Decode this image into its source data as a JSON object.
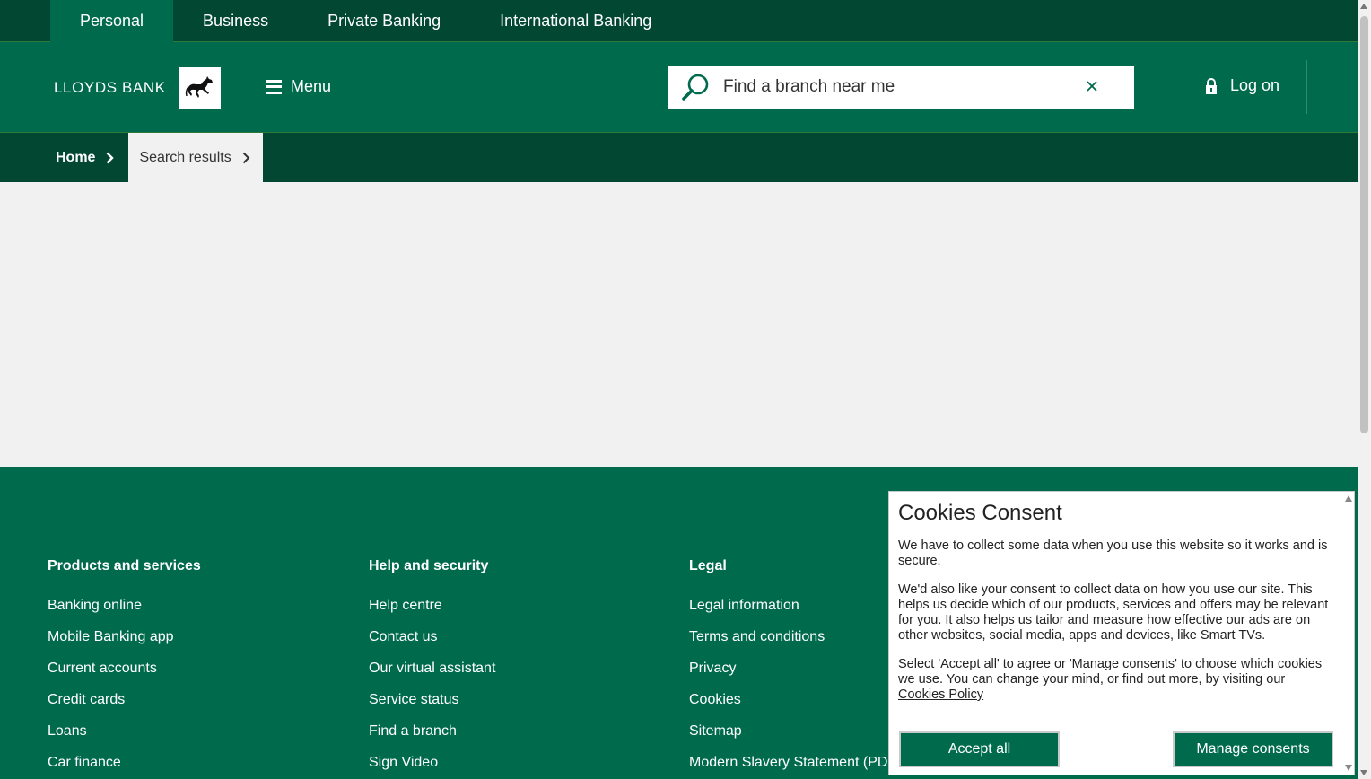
{
  "segments": [
    {
      "label": "Personal",
      "active": true
    },
    {
      "label": "Business",
      "active": false
    },
    {
      "label": "Private Banking",
      "active": false
    },
    {
      "label": "International Banking",
      "active": false
    }
  ],
  "header": {
    "brand": "LLOYDS BANK",
    "logo_icon": "black-horse-icon",
    "menu_label": "Menu",
    "search": {
      "value": "Find a branch near me",
      "placeholder": "Find a branch near me"
    },
    "logon_label": "Log on"
  },
  "breadcrumb": [
    {
      "label": "Home"
    },
    {
      "label": "Search results"
    }
  ],
  "footer": {
    "columns": [
      {
        "heading": "Products and services",
        "links": [
          "Banking online",
          "Mobile Banking app",
          "Current accounts",
          "Credit cards",
          "Loans",
          "Car finance"
        ]
      },
      {
        "heading": "Help and security",
        "links": [
          "Help centre",
          "Contact us",
          "Our virtual assistant",
          "Service status",
          "Find a branch",
          "Sign Video"
        ]
      },
      {
        "heading": "Legal",
        "links": [
          "Legal information",
          "Terms and conditions",
          "Privacy",
          "Cookies",
          "Sitemap",
          "Modern Slavery Statement (PD"
        ]
      }
    ]
  },
  "cookies": {
    "title": "Cookies Consent",
    "p1": "We have to collect some data when you use this website so it works and is secure.",
    "p2": "We'd also like your consent to collect data on how you use our site. This helps us decide which of our products, services and offers may be relevant for you. It also helps us tailor and measure how effective our ads are on other websites, social media, apps and devices, like Smart TVs.",
    "p3_prefix": "Select 'Accept all' to agree or 'Manage consents' to choose which cookies we use. You can change your mind, or find out more, by visiting our ",
    "policy_link": "Cookies Policy",
    "accept_label": "Accept all",
    "manage_label": "Manage consents"
  },
  "colors": {
    "brand_green": "#006a4d",
    "dark_green": "#024731"
  }
}
